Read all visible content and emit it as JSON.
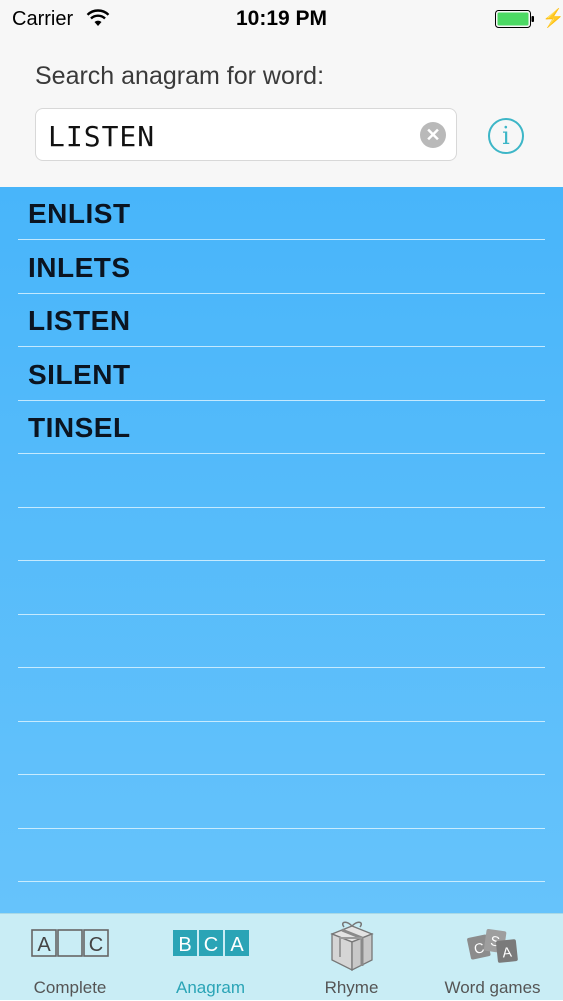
{
  "status_bar": {
    "carrier": "Carrier",
    "time": "10:19 PM",
    "battery_color": "#4cd964"
  },
  "search": {
    "label": "Search anagram for word:",
    "value": "LISTEN",
    "clear_symbol": "✕",
    "info_symbol": "i"
  },
  "results": [
    "ENLIST",
    "INLETS",
    "LISTEN",
    "SILENT",
    "TINSEL"
  ],
  "tabs": [
    {
      "label": "Complete",
      "icon": "ac-letters-icon",
      "active": false
    },
    {
      "label": "Anagram",
      "icon": "bca-letters-icon",
      "active": true
    },
    {
      "label": "Rhyme",
      "icon": "gift-icon",
      "active": false
    },
    {
      "label": "Word games",
      "icon": "letter-cards-icon",
      "active": false
    }
  ],
  "tab_icon_letters": {
    "complete": [
      "A",
      "C"
    ],
    "anagram": [
      "B",
      "C",
      "A"
    ],
    "word_games": [
      "C",
      "S",
      "A"
    ]
  },
  "colors": {
    "accent": "#2aa4b6",
    "list_background": "#4db8fa",
    "tab_bar": "#c9edf5"
  }
}
